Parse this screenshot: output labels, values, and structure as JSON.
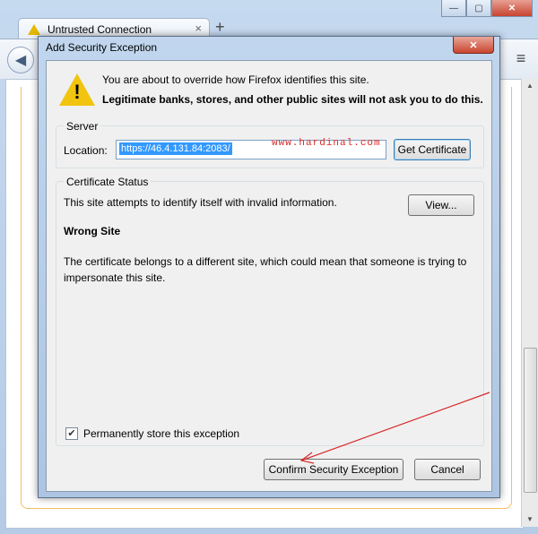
{
  "browser": {
    "tab_title": "Untrusted Connection",
    "tab_close": "×",
    "new_tab": "+",
    "back": "◀",
    "menu": "≡"
  },
  "dialog": {
    "title": "Add Security Exception",
    "close": "✕",
    "message_line1": "You are about to override how Firefox identifies this site.",
    "message_line2": "Legitimate banks, stores, and other public sites will not ask you to do this.",
    "server": {
      "legend": "Server",
      "location_label": "Location:",
      "location_value": "https://46.4.131.84:2083/",
      "get_certificate": "Get Certificate"
    },
    "status": {
      "legend": "Certificate Status",
      "description": "This site attempts to identify itself with invalid information.",
      "view_button": "View...",
      "wrong_site": "Wrong Site",
      "detail": "The certificate belongs to a different site, which could mean that someone is trying to impersonate this site.",
      "permanent_label": "Permanently store this exception",
      "permanent_checked": true
    },
    "confirm_button": "Confirm Security Exception",
    "cancel_button": "Cancel"
  },
  "watermark": "www.hardinal.com",
  "colors": {
    "selection": "#3399ff",
    "annotation_arrow": "#d62828",
    "warning": "#f1c40f"
  }
}
